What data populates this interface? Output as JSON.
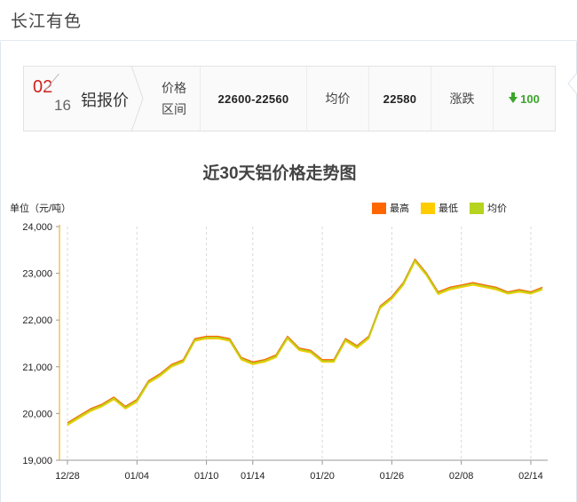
{
  "header": {
    "title": "长江有色"
  },
  "quote": {
    "date_month": "02",
    "date_day": "16",
    "metal_name": "铝报价",
    "range_label_line1": "价格",
    "range_label_line2": "区间",
    "range_value": "22600-22560",
    "avg_label": "均价",
    "avg_value": "22580",
    "change_label": "涨跌",
    "change_value": "100",
    "change_direction": "down",
    "change_color": "#3aa62a"
  },
  "chart_data": {
    "type": "line",
    "title": "近30天铝价格走势图",
    "ylabel": "单位（元/吨）",
    "ylim": [
      19000,
      24000
    ],
    "yticks": [
      "19,000",
      "20,000",
      "21,000",
      "22,000",
      "23,000",
      "24,000"
    ],
    "ytick_values": [
      19000,
      20000,
      21000,
      22000,
      23000,
      24000
    ],
    "x": [
      "12/28",
      "12/29",
      "12/30",
      "12/31",
      "01/02",
      "01/03",
      "01/04",
      "01/05",
      "01/06",
      "01/07",
      "01/08",
      "01/09",
      "01/10",
      "01/11",
      "01/12",
      "01/13",
      "01/14",
      "01/15",
      "01/16",
      "01/17",
      "01/18",
      "01/19",
      "01/20",
      "01/21",
      "01/22",
      "01/23",
      "01/26",
      "01/27",
      "01/28",
      "02/03",
      "02/04",
      "02/05",
      "02/06",
      "02/07",
      "02/08",
      "02/09",
      "02/10",
      "02/11",
      "02/12",
      "02/13",
      "02/14",
      "02/16"
    ],
    "xtick_labels": [
      "12/28",
      "01/04",
      "01/10",
      "01/14",
      "01/20",
      "01/26",
      "02/08",
      "02/14"
    ],
    "xtick_index": [
      0,
      6,
      12,
      16,
      22,
      28,
      34,
      40
    ],
    "legend_position": "top-right",
    "grid": "vertical dashed",
    "series": [
      {
        "name": "最高",
        "color": "#ff6600",
        "values": [
          19800,
          19950,
          20100,
          20200,
          20350,
          20150,
          20300,
          20700,
          20850,
          21050,
          21150,
          21600,
          21650,
          21650,
          21600,
          21200,
          21100,
          21150,
          21250,
          21650,
          21400,
          21350,
          21150,
          21150,
          21600,
          21450,
          21650,
          22300,
          22500,
          22800,
          23300,
          23000,
          22600,
          22700,
          22750,
          22800,
          22750,
          22700,
          22600,
          22650,
          22600,
          22700
        ]
      },
      {
        "name": "最低",
        "color": "#ffcc00",
        "values": [
          19750,
          19900,
          20050,
          20150,
          20300,
          20100,
          20250,
          20650,
          20800,
          21000,
          21100,
          21550,
          21600,
          21600,
          21550,
          21150,
          21050,
          21100,
          21200,
          21600,
          21350,
          21300,
          21100,
          21100,
          21550,
          21400,
          21600,
          22250,
          22450,
          22750,
          23250,
          22950,
          22550,
          22650,
          22700,
          22750,
          22700,
          22650,
          22560,
          22600,
          22560,
          22650
        ]
      },
      {
        "name": "均价",
        "color": "#b5d31f",
        "values": [
          19775,
          19925,
          20075,
          20175,
          20325,
          20125,
          20275,
          20675,
          20825,
          21025,
          21125,
          21575,
          21625,
          21625,
          21575,
          21175,
          21075,
          21125,
          21225,
          21625,
          21375,
          21325,
          21125,
          21125,
          21575,
          21425,
          21625,
          22275,
          22475,
          22775,
          23275,
          22975,
          22575,
          22675,
          22725,
          22775,
          22725,
          22675,
          22580,
          22625,
          22580,
          22675
        ]
      }
    ]
  }
}
